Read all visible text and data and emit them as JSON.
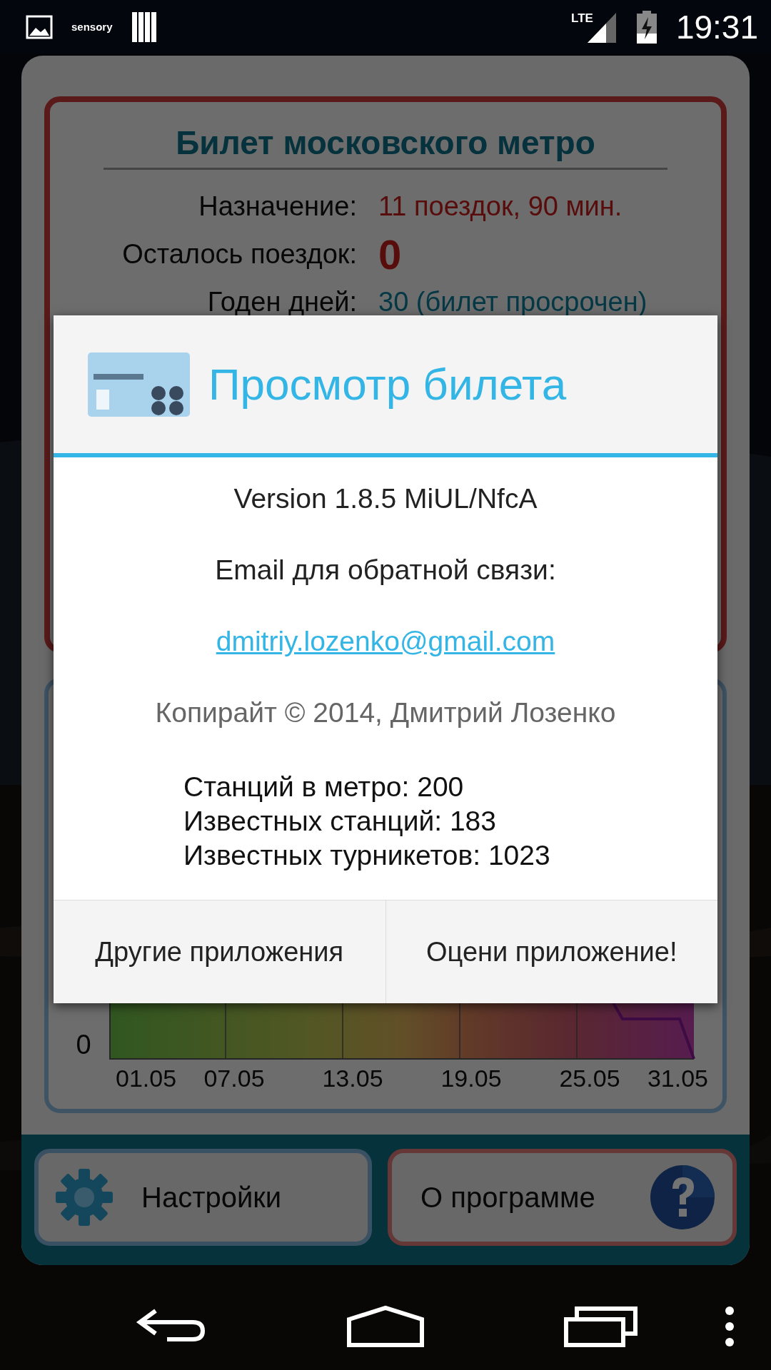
{
  "status_bar": {
    "notification_label": "sensory",
    "network": "LTE",
    "time": "19:31"
  },
  "ticket": {
    "title": "Билет московского метро",
    "rows": [
      {
        "label": "Назначение:",
        "value": "11 поездок, 90 мин.",
        "kind": "text"
      },
      {
        "label": "Осталось поездок:",
        "value": "0",
        "kind": "count"
      },
      {
        "label": "Годен дней:",
        "value": "30 (билет просрочен)",
        "kind": "info"
      }
    ]
  },
  "chart": {
    "y_label": "0",
    "x_labels": [
      "01.05",
      "07.05",
      "13.05",
      "19.05",
      "25.05",
      "31.05"
    ]
  },
  "buttons": [
    {
      "label": "Настройки",
      "kind": "settings"
    },
    {
      "label": "О программе",
      "kind": "about"
    }
  ],
  "dialog": {
    "title": "Просмотр билета",
    "version": "Version 1.8.5 MiUL/NfcA",
    "email_label": "Email для обратной связи:",
    "email": "dmitriy.lozenko@gmail.com",
    "copyright": "Копирайт © 2014, Дмитрий Лозенко",
    "stats": [
      "Станций в метро: 200",
      "Известных станций: 183",
      "Известных турникетов: 1023"
    ],
    "buttons": [
      "Другие приложения",
      "Оцени приложение!"
    ]
  }
}
